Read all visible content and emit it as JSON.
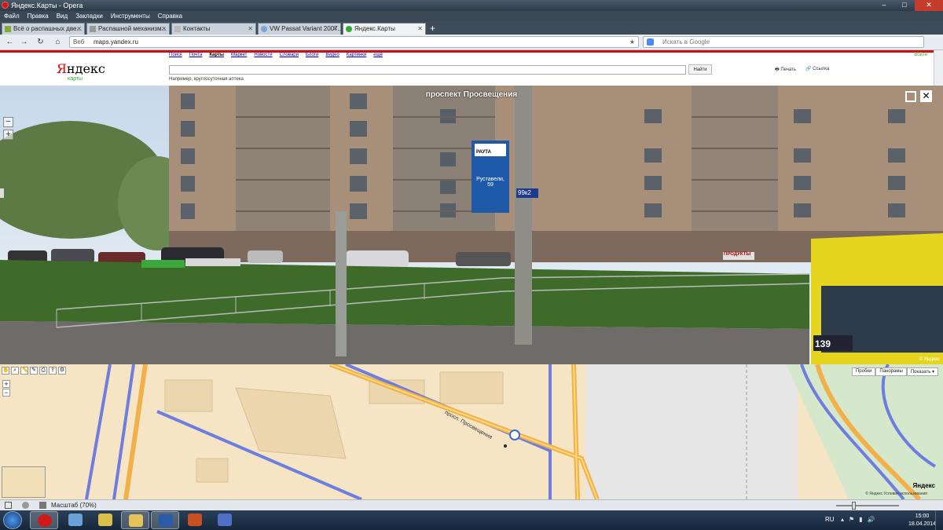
{
  "window": {
    "title": "Яндекс.Карты - Opera",
    "controls": [
      "–",
      "□",
      "✕"
    ]
  },
  "menu": [
    "Файл",
    "Правка",
    "Вид",
    "Закладки",
    "Инструменты",
    "Справка"
  ],
  "tabs": [
    {
      "label": "Всё о распашных две...",
      "icon": "page-icon"
    },
    {
      "label": "Распашной механизм...",
      "icon": "page-icon"
    },
    {
      "label": "Контакты",
      "icon": "page-icon"
    },
    {
      "label": "VW Passat Variant 2007...",
      "icon": "globe-icon"
    },
    {
      "label": "Яндекс.Карты",
      "icon": "yandex-maps-icon"
    }
  ],
  "tab_add": "+",
  "address": {
    "label": "Веб",
    "url": "maps.yandex.ru",
    "search_placeholder": "Искать в Google"
  },
  "yandex": {
    "logo_first": "Я",
    "logo_rest": "ндекс",
    "service": "карты",
    "nav": [
      "Поиск",
      "Почта",
      "Карты",
      "Маркет",
      "Новости",
      "Словари",
      "Блоги",
      "Видео",
      "Картинки",
      "ещё"
    ],
    "current_nav": "Карты",
    "find_button": "Найти",
    "hint": "Например, круглосуточная аптека",
    "print": "Печать",
    "link": "Ссылка",
    "login": "Войти"
  },
  "panorama": {
    "street": "проспект Просвещения",
    "sign_brand": "РАУТА",
    "sign_address": "Руставели, 59",
    "house_number": "99к2",
    "bus_number": "139",
    "shop_sign": "ПРОДУКТЫ",
    "credit": "© Яндекс",
    "zoom_in": "+",
    "zoom_out": "−",
    "close": "✕"
  },
  "map": {
    "layers": [
      "Пробки",
      "Панорамы",
      "Показать ▾"
    ],
    "zoom_in": "+",
    "zoom_out": "−",
    "street_label": "просп. Просвещения",
    "logo": "Яндекс",
    "copyright": "© Яндекс  Условия использования"
  },
  "status": {
    "zoom": "Масштаб (70%)"
  },
  "taskbar": {
    "lang": "RU",
    "time": "15:00",
    "date": "18.04.2014"
  }
}
